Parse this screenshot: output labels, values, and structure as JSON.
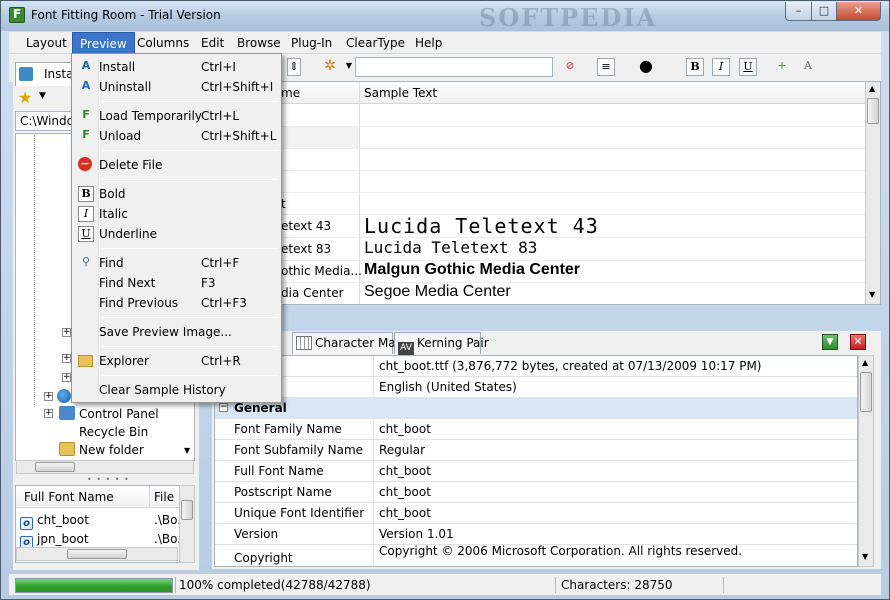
{
  "window": {
    "title": "Font Fitting Room - Trial Version",
    "watermark": "SOFTPEDIA",
    "min": "–",
    "max": "□",
    "close": "✕"
  },
  "menubar": [
    "Layout",
    "Preview",
    "Columns",
    "Edit",
    "Browse",
    "Plug-In",
    "ClearType",
    "Help"
  ],
  "left": {
    "tab_label": "Instal",
    "path": "C:\\Windo",
    "tree": [
      "Control Panel",
      "Recycle Bin",
      "New folder"
    ],
    "list_headers": {
      "col1": "Full Font Name",
      "col2": "File"
    },
    "list_rows": [
      {
        "name": "cht_boot",
        "file": ".\\Bo."
      },
      {
        "name": "jpn_boot",
        "file": ".\\Bo."
      }
    ]
  },
  "grid": {
    "headers": {
      "col1": "me",
      "col2": "Sample Text"
    },
    "rows": [
      {
        "name": "",
        "sample": ""
      },
      {
        "name": "",
        "sample": ""
      },
      {
        "name": "",
        "sample": ""
      },
      {
        "name": "",
        "sample": ""
      },
      {
        "name": "t",
        "sample": ""
      },
      {
        "name": "etext 43",
        "sample": "Lucida Teletext 43"
      },
      {
        "name": "etext 83",
        "sample": "Lucida Teletext 83"
      },
      {
        "name": "othic Media...",
        "sample": "Malgun Gothic Media Center"
      },
      {
        "name": "dia Center",
        "sample": "Segoe Media Center"
      }
    ]
  },
  "details": {
    "tabs": [
      "s",
      "Character Map",
      "Kerning Pair"
    ],
    "top_rows": [
      {
        "key": "e",
        "value": "cht_boot.ttf (3,876,772 bytes, created at 07/13/2009 10:17 PM)"
      },
      {
        "key": "",
        "value": "English (United States)"
      }
    ],
    "group_label": "General",
    "group_toggle": "−",
    "rows": [
      {
        "key": "Font Family Name",
        "value": "cht_boot"
      },
      {
        "key": "Font Subfamily Name",
        "value": "Regular"
      },
      {
        "key": "Full Font Name",
        "value": "cht_boot"
      },
      {
        "key": "Postscript Name",
        "value": "cht_boot"
      },
      {
        "key": "Unique Font Identifier",
        "value": "cht_boot"
      },
      {
        "key": "Version",
        "value": "Version 1.01"
      },
      {
        "key": "Copyright",
        "value": "Copyright © 2006 Microsoft Corporation. All rights reserved."
      }
    ]
  },
  "status": {
    "progress": 1.0,
    "progress_text": "100% completed(42788/42788)",
    "characters": "Characters: 28750"
  },
  "dropdown": [
    {
      "type": "item",
      "icon": "install-icon",
      "glyph": "A",
      "label": "Install",
      "shortcut": "Ctrl+I"
    },
    {
      "type": "item",
      "icon": "uninstall-icon",
      "glyph": "A",
      "label": "Uninstall",
      "shortcut": "Ctrl+Shift+I"
    },
    {
      "type": "sep"
    },
    {
      "type": "item",
      "icon": "load-temporarily-icon",
      "glyph": "F",
      "label": "Load Temporarily",
      "shortcut": "Ctrl+L"
    },
    {
      "type": "item",
      "icon": "unload-icon",
      "glyph": "F",
      "label": "Unload",
      "shortcut": "Ctrl+Shift+L"
    },
    {
      "type": "sep"
    },
    {
      "type": "item",
      "icon": "delete-file-icon",
      "glyph": "−",
      "label": "Delete File",
      "shortcut": ""
    },
    {
      "type": "sep"
    },
    {
      "type": "item",
      "icon": "bold-icon",
      "glyph": "B",
      "label": "Bold",
      "shortcut": ""
    },
    {
      "type": "item",
      "icon": "italic-icon",
      "glyph": "I",
      "label": "Italic",
      "shortcut": ""
    },
    {
      "type": "item",
      "icon": "underline-icon",
      "glyph": "U",
      "label": "Underline",
      "shortcut": ""
    },
    {
      "type": "sep"
    },
    {
      "type": "item",
      "icon": "find-icon",
      "glyph": "⚲",
      "label": "Find",
      "shortcut": "Ctrl+F"
    },
    {
      "type": "item",
      "icon": "",
      "glyph": "",
      "label": "Find Next",
      "shortcut": "F3"
    },
    {
      "type": "item",
      "icon": "",
      "glyph": "",
      "label": "Find Previous",
      "shortcut": "Ctrl+F3"
    },
    {
      "type": "sep"
    },
    {
      "type": "item",
      "icon": "",
      "glyph": "",
      "label": "Save Preview Image...",
      "shortcut": ""
    },
    {
      "type": "sep"
    },
    {
      "type": "item",
      "icon": "explorer-icon",
      "glyph": "▭",
      "label": "Explorer",
      "shortcut": "Ctrl+R"
    },
    {
      "type": "sep"
    },
    {
      "type": "item",
      "icon": "",
      "glyph": "",
      "label": "Clear Sample History",
      "shortcut": ""
    }
  ]
}
